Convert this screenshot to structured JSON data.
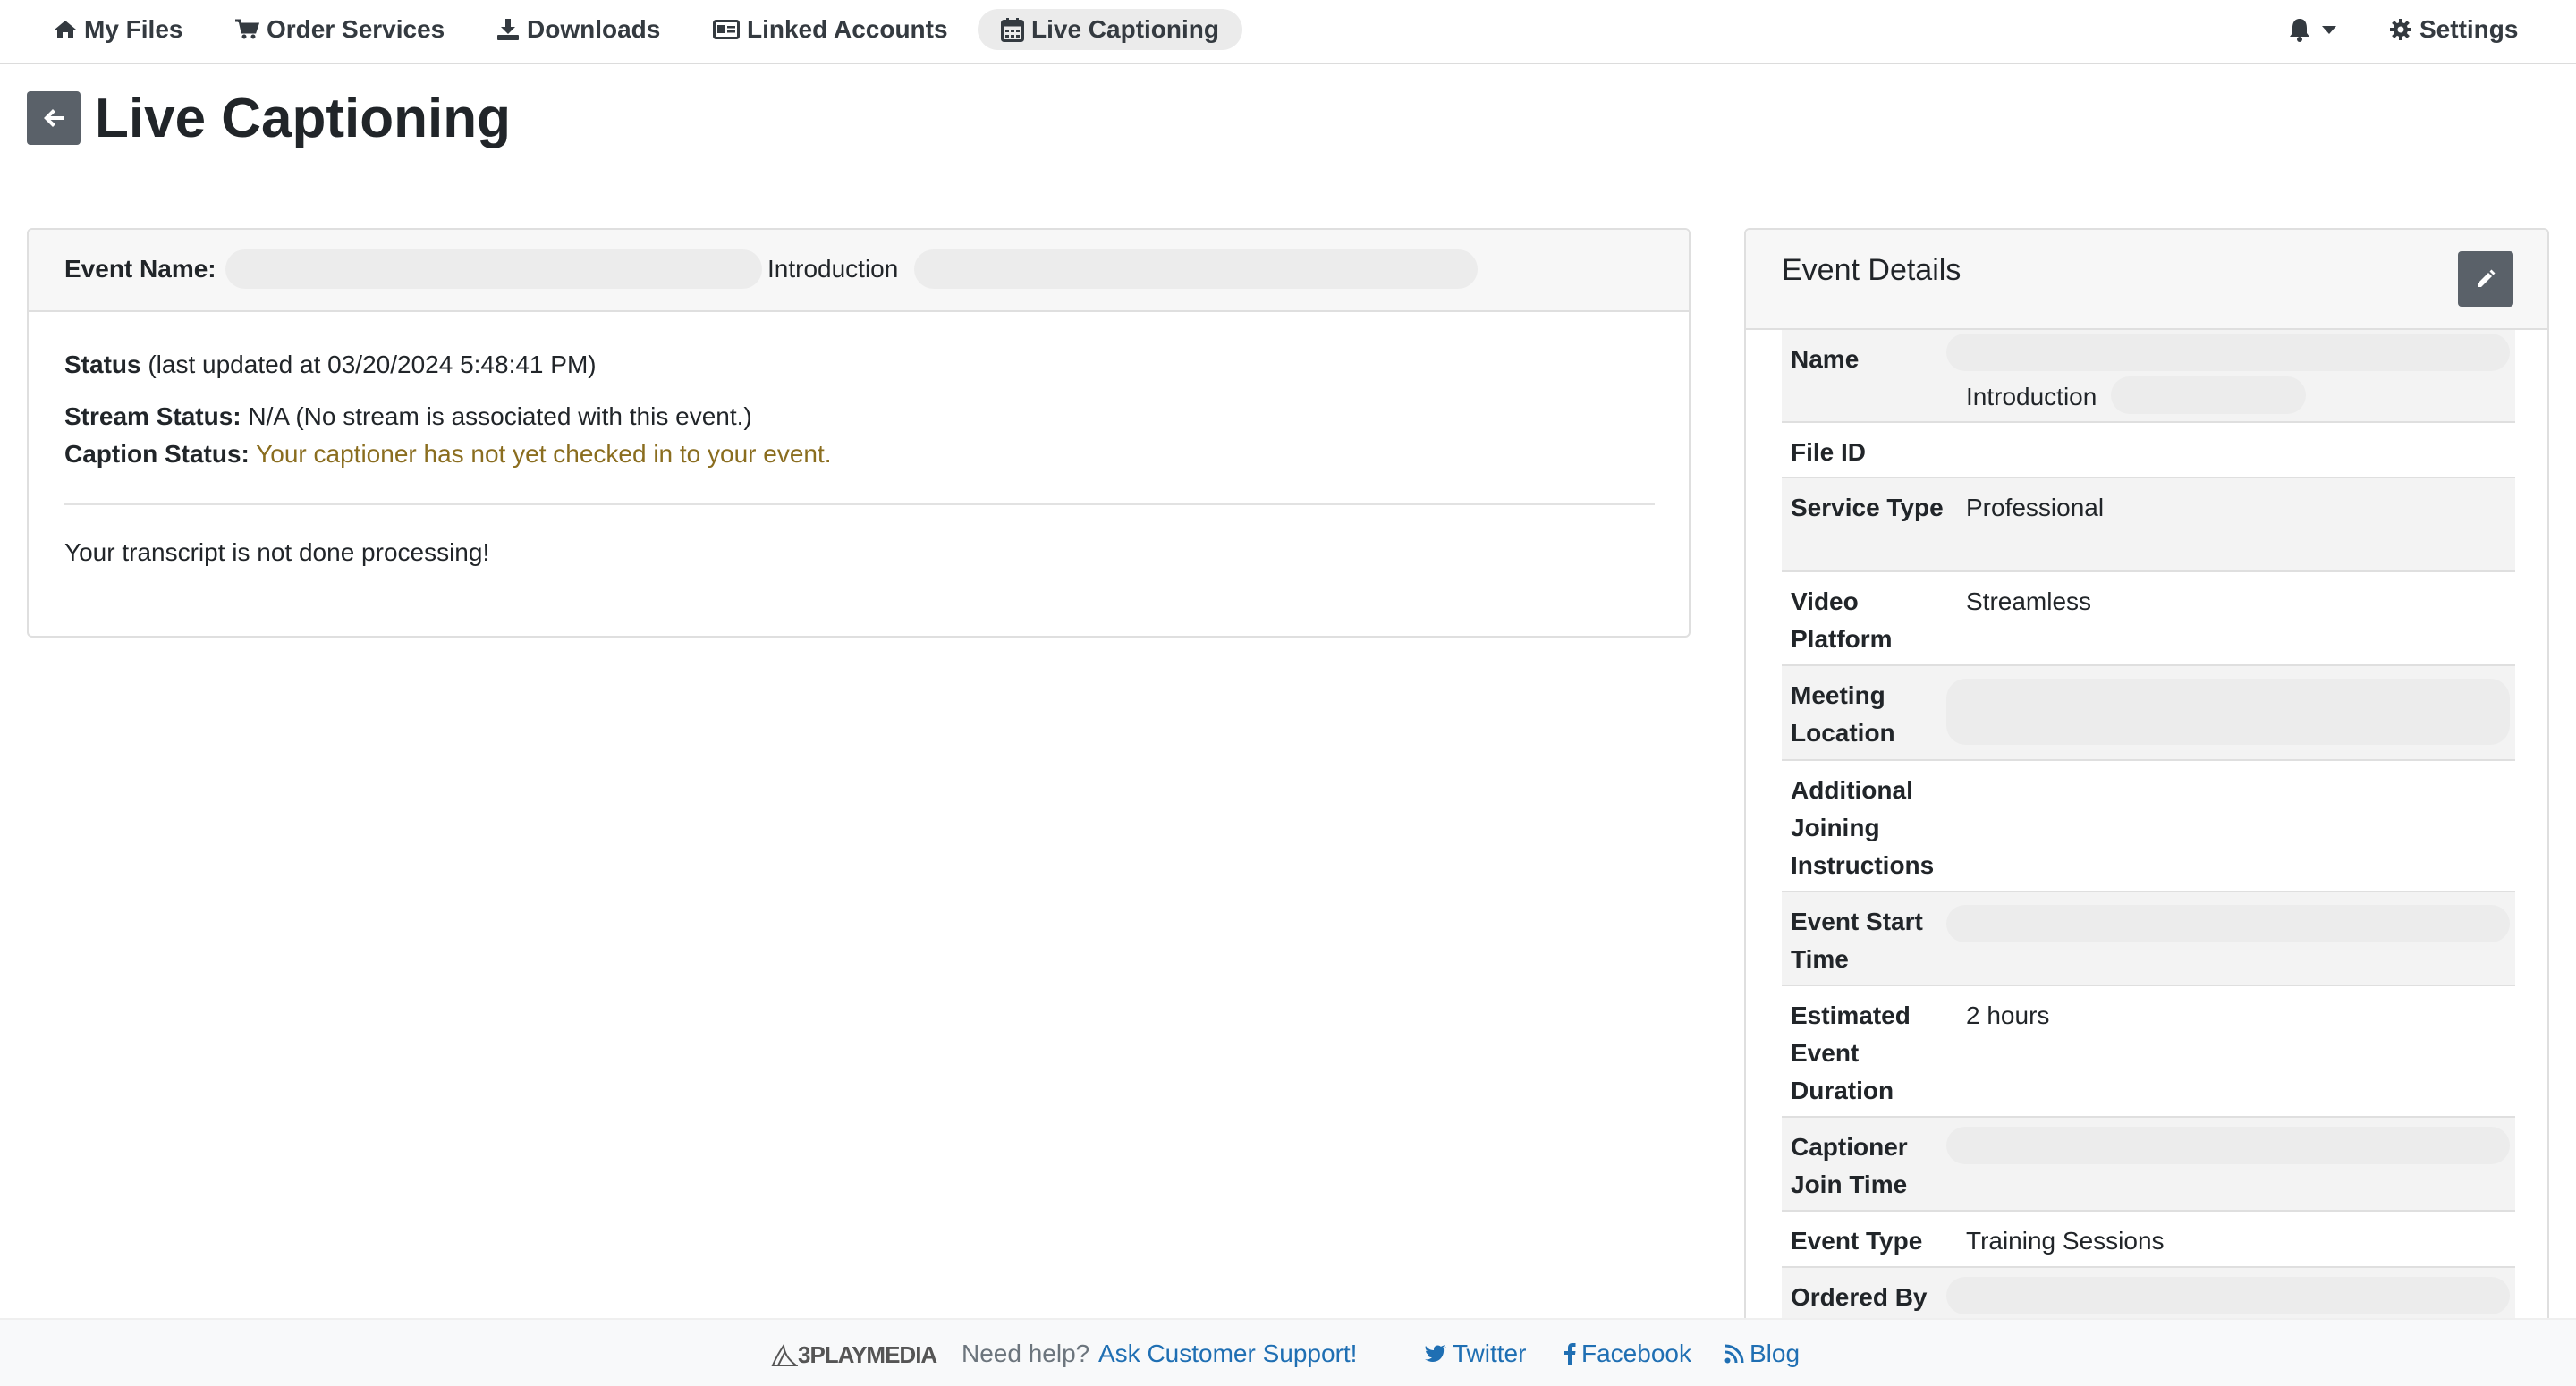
{
  "nav": {
    "my_files": "My Files",
    "order_services": "Order Services",
    "downloads": "Downloads",
    "linked_accounts": "Linked Accounts",
    "live_captioning": "Live Captioning",
    "settings": "Settings",
    "active": "Live Captioning"
  },
  "page": {
    "title": "Live Captioning"
  },
  "event_card": {
    "event_name_label": "Event Name:",
    "event_name_fragment": "Introduction",
    "status_label": "Status",
    "status_updated": "(last updated at 03/20/2024 5:48:41 PM)",
    "stream_status_label": "Stream Status:",
    "stream_status_value": "N/A (No stream is associated with this event.)",
    "caption_status_label": "Caption Status:",
    "caption_status_value": "Your captioner has not yet checked in to your event.",
    "transcript_message": "Your transcript is not done processing!"
  },
  "details": {
    "title": "Event Details",
    "rows": [
      {
        "label": "Name",
        "value": "Introduction"
      },
      {
        "label": "File ID",
        "value": ""
      },
      {
        "label": "Service Type",
        "value": "Professional"
      },
      {
        "label": "Video Platform",
        "value": "Streamless"
      },
      {
        "label": "Meeting Location",
        "value": ""
      },
      {
        "label": "Additional Joining Instructions",
        "value": ""
      },
      {
        "label": "Event Start Time",
        "value": ""
      },
      {
        "label": "Estimated Event Duration",
        "value": "2 hours"
      },
      {
        "label": "Captioner Join Time",
        "value": ""
      },
      {
        "label": "Event Type",
        "value": "Training Sessions"
      },
      {
        "label": "Ordered By",
        "value": ""
      }
    ]
  },
  "footer": {
    "logo_text": "3PLAYMEDIA",
    "help_text": "Need help?",
    "support_link": "Ask Customer Support!",
    "twitter": "Twitter",
    "facebook": "Facebook",
    "blog": "Blog"
  },
  "colors": {
    "caption_status": "#8a6d1f",
    "link": "#1f6fb3",
    "button_bg": "#5a6169"
  },
  "icons": [
    "home-icon",
    "cart-icon",
    "download-icon",
    "id-card-icon",
    "calendar-icon",
    "bell-icon",
    "gear-icon",
    "arrow-left-icon",
    "pencil-icon",
    "twitter-icon",
    "facebook-icon",
    "rss-icon"
  ]
}
